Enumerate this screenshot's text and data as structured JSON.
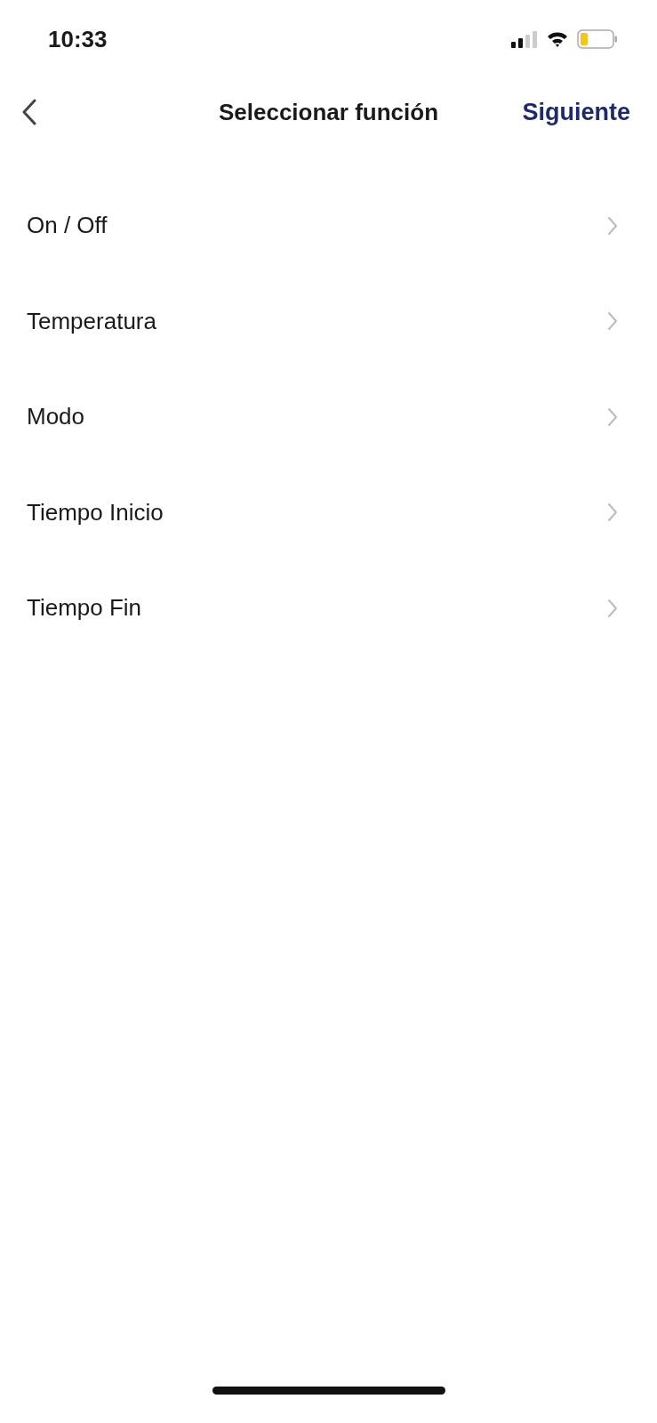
{
  "status_bar": {
    "time": "10:33"
  },
  "header": {
    "title": "Seleccionar función",
    "action": "Siguiente"
  },
  "functions": [
    {
      "label": "On / Off"
    },
    {
      "label": "Temperatura"
    },
    {
      "label": "Modo"
    },
    {
      "label": "Tiempo Inicio"
    },
    {
      "label": "Tiempo Fin"
    }
  ]
}
